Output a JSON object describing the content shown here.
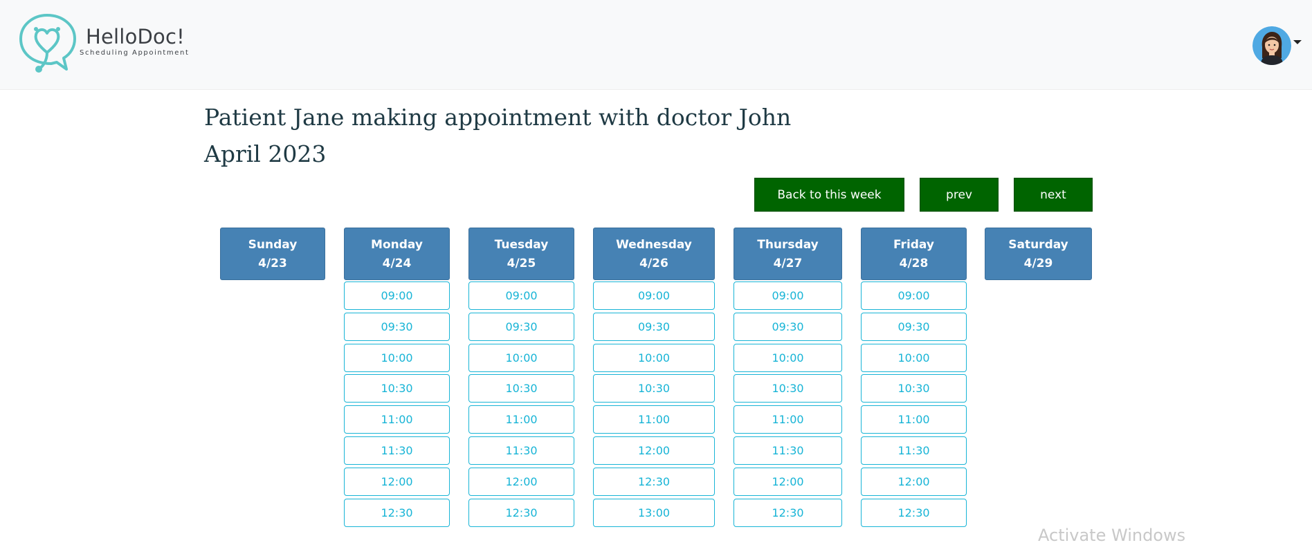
{
  "brand": {
    "name": "HelloDoc!",
    "tagline": "Scheduling Appointment",
    "logo_color": "#5cc6c6"
  },
  "header": {
    "title": "Patient Jane making appointment with doctor John",
    "month": "April 2023"
  },
  "nav": {
    "back_label": "Back to this week",
    "prev_label": "prev",
    "next_label": "next",
    "button_color": "#006400"
  },
  "colors": {
    "day_header": "#4682b4",
    "slot_text": "#17b4d6",
    "slot_border": "#17b4d6"
  },
  "days": [
    {
      "name": "Sunday",
      "date": "4/23",
      "slots": []
    },
    {
      "name": "Monday",
      "date": "4/24",
      "slots": [
        "09:00",
        "09:30",
        "10:00",
        "10:30",
        "11:00",
        "11:30",
        "12:00",
        "12:30"
      ]
    },
    {
      "name": "Tuesday",
      "date": "4/25",
      "slots": [
        "09:00",
        "09:30",
        "10:00",
        "10:30",
        "11:00",
        "11:30",
        "12:00",
        "12:30"
      ]
    },
    {
      "name": "Wednesday",
      "date": "4/26",
      "slots": [
        "09:00",
        "09:30",
        "10:00",
        "10:30",
        "11:00",
        "12:00",
        "12:30",
        "13:00"
      ]
    },
    {
      "name": "Thursday",
      "date": "4/27",
      "slots": [
        "09:00",
        "09:30",
        "10:00",
        "10:30",
        "11:00",
        "11:30",
        "12:00",
        "12:30"
      ]
    },
    {
      "name": "Friday",
      "date": "4/28",
      "slots": [
        "09:00",
        "09:30",
        "10:00",
        "10:30",
        "11:00",
        "11:30",
        "12:00",
        "12:30"
      ]
    },
    {
      "name": "Saturday",
      "date": "4/29",
      "slots": []
    }
  ],
  "watermark": "Activate Windows"
}
